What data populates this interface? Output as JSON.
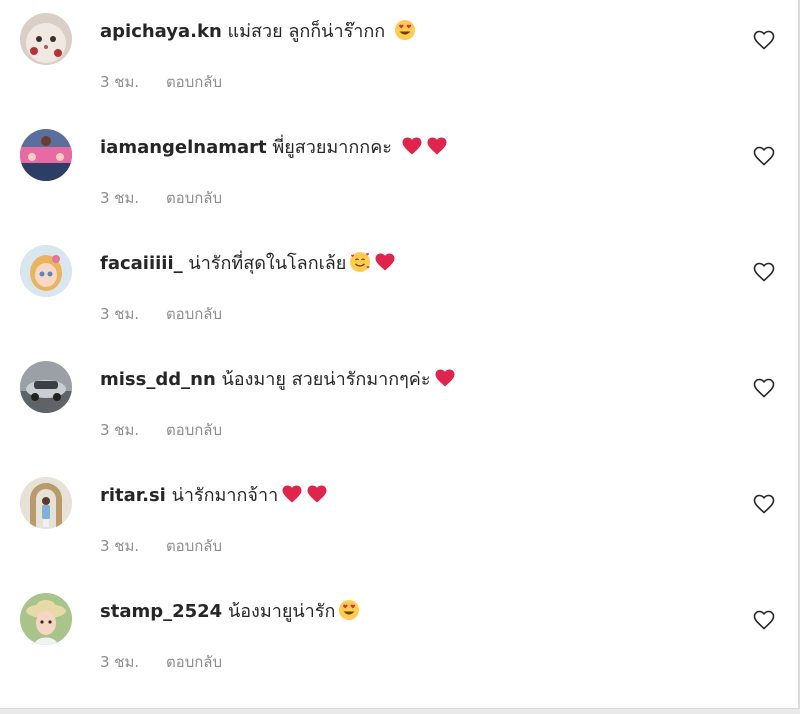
{
  "comments": [
    {
      "username": "apichaya.kn",
      "text": "แม่สวย ลูกก็น่าร๊ากก",
      "emojis": [
        "heart-eyes-emoji"
      ],
      "time": "3 ชม.",
      "reply_label": "ตอบกลับ",
      "avatar": "cat-avatar"
    },
    {
      "username": "iamangelnamart",
      "text": "พี่ยูสวยมากกคะ",
      "emojis": [
        "red-heart-emoji",
        "red-heart-emoji"
      ],
      "time": "3 ชม.",
      "reply_label": "ตอบกลับ",
      "avatar": "group-photo-avatar"
    },
    {
      "username": "facaiiiii_",
      "text": "น่ารักที่สุดในโลกเล้ย",
      "emojis": [
        "smiling-hearts-emoji",
        "red-heart-emoji"
      ],
      "time": "3 ชม.",
      "reply_label": "ตอบกลับ",
      "avatar": "cartoon-girl-avatar"
    },
    {
      "username": "miss_dd_nn",
      "text": "น้องมายู สวยน่ารักมากๆค่ะ",
      "emojis": [
        "red-heart-emoji"
      ],
      "time": "3 ชม.",
      "reply_label": "ตอบกลับ",
      "avatar": "car-photo-avatar"
    },
    {
      "username": "ritar.si",
      "text": "น่ารักมากจ้าา",
      "emojis": [
        "red-heart-emoji",
        "red-heart-emoji"
      ],
      "time": "3 ชม.",
      "reply_label": "ตอบกลับ",
      "avatar": "person-arch-avatar"
    },
    {
      "username": "stamp_2524",
      "text": "น้องมายูน่ารัก",
      "emojis": [
        "heart-eyes-emoji"
      ],
      "time": "3 ชม.",
      "reply_label": "ตอบกลับ",
      "avatar": "woman-hat-avatar"
    }
  ],
  "like_icon": "heart-outline-icon",
  "colors": {
    "text": "#262626",
    "meta": "#8e8e8e",
    "heart": "#e0244b",
    "emoji_face": "#ffcc4d"
  }
}
